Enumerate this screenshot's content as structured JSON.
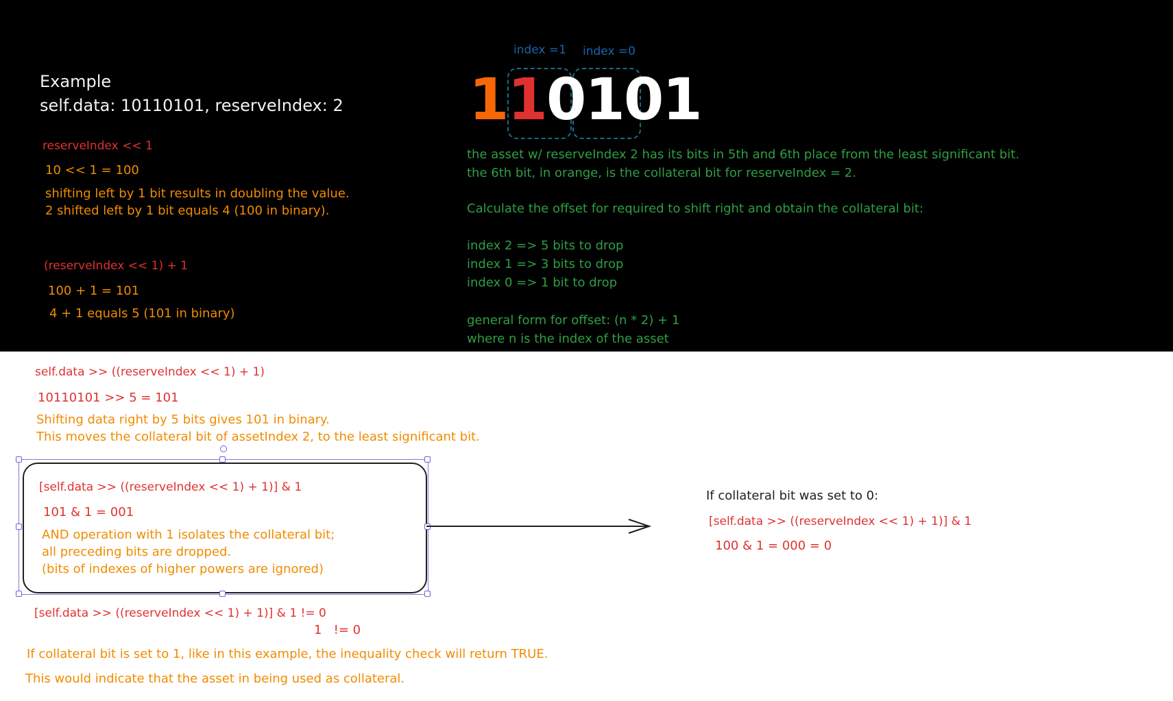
{
  "example": {
    "heading": "Example",
    "subheading": "self.data: 10110101, reserveIndex: 2"
  },
  "shift_left": {
    "title": "reserveIndex << 1",
    "result": "10 << 1 = 100",
    "line1": "shifting left by 1 bit results in doubling the value.",
    "line2": "2 shifted left by 1 bit equals 4 (100 in binary)."
  },
  "plus_one": {
    "title": "(reserveIndex << 1) + 1",
    "result": "100 + 1 = 101",
    "line1": "4 + 1 equals 5 (101 in binary)"
  },
  "bits_graphic": {
    "label_index1": "index =1",
    "label_index0": "index =0",
    "digits": [
      "1",
      "1",
      "0",
      "1",
      "0",
      "1"
    ],
    "highlight_color_1": "#f76707",
    "highlight_color_2": "#e03131",
    "digit_color": "#ffffff"
  },
  "explanation": {
    "line1": "the asset w/ reserveIndex 2 has its bits in 5th and 6th place from the least significant bit.",
    "line2": "the 6th bit, in orange, is the collateral bit for reserveIndex = 2.",
    "line3": "Calculate the offset for required to shift right and obtain the collateral bit:",
    "line4": "index 2 => 5 bits to drop",
    "line5": "index 1 => 3 bits to drop",
    "line6": "index 0 => 1 bit to drop",
    "line7": "general form for offset: (n * 2) + 1",
    "line8": "where n is the index of the asset"
  },
  "shift_right": {
    "title": "self.data >> ((reserveIndex << 1) + 1)",
    "result": "10110101 >> 5 = 101",
    "line1": "Shifting data right by 5 bits gives 101 in binary.",
    "line2": "This moves the collateral bit of assetIndex 2, to the least significant bit."
  },
  "and_box": {
    "title": "[self.data >> ((reserveIndex << 1) + 1)] & 1",
    "result": "101 & 1 = 001",
    "line1": "AND operation with 1 isolates the collateral bit;",
    "line2": "all preceding bits are dropped.",
    "line3": "(bits of indexes of higher powers are ignored)"
  },
  "inequality": {
    "line1": "[self.data >> ((reserveIndex << 1) + 1)] & 1 != 0",
    "line2": "1   != 0",
    "note1": "If collateral bit is set to 1, like in this example, the inequality check will return TRUE.",
    "note2": "This would indicate that the asset in being used as collateral."
  },
  "zero_case": {
    "title": "If collateral bit was set to 0:",
    "expr": "[self.data >> ((reserveIndex << 1) + 1)] & 1",
    "result": "100 & 1 = 000 = 0"
  }
}
